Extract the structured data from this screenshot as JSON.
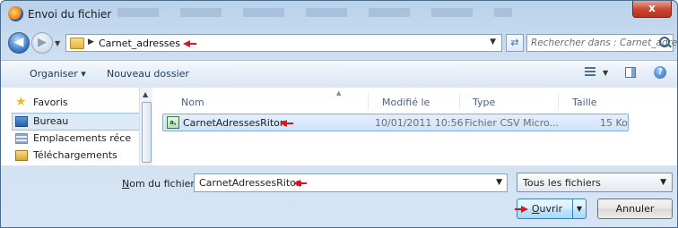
{
  "window": {
    "title": "Envoi du fichier",
    "close_glyph": "x"
  },
  "address": {
    "crumb": "Carnet_adresses",
    "search_placeholder": "Rechercher dans : Carnet_adre..."
  },
  "toolbar": {
    "organize_label": "Organiser ▾",
    "new_folder_label": "Nouveau dossier"
  },
  "sidebar": {
    "items": [
      {
        "label": "Favoris",
        "icon": "star-icon"
      },
      {
        "label": "Bureau",
        "icon": "desktop-icon"
      },
      {
        "label": "Emplacements réce",
        "icon": "recent-places-icon"
      },
      {
        "label": "Téléchargements",
        "icon": "downloads-icon"
      }
    ]
  },
  "file_list": {
    "columns": [
      "Nom",
      "Modifié le",
      "Type",
      "Taille"
    ],
    "rows": [
      {
        "name": "CarnetAdressesRiton",
        "modified": "10/01/2011 10:56",
        "type": "Fichier CSV Micro...",
        "size": "15 Ko"
      }
    ]
  },
  "footer": {
    "filename_label_prefix": "N",
    "filename_label_rest": "om du fichier :",
    "filename_value": "CarnetAdressesRiton",
    "filter_value": "Tous les fichiers",
    "open_label_prefix": "O",
    "open_label_rest": "uvrir",
    "cancel_label": "Annuler"
  },
  "colors": {
    "annotation_arrow": "#e0141e",
    "selection": "#cfe3fa"
  }
}
